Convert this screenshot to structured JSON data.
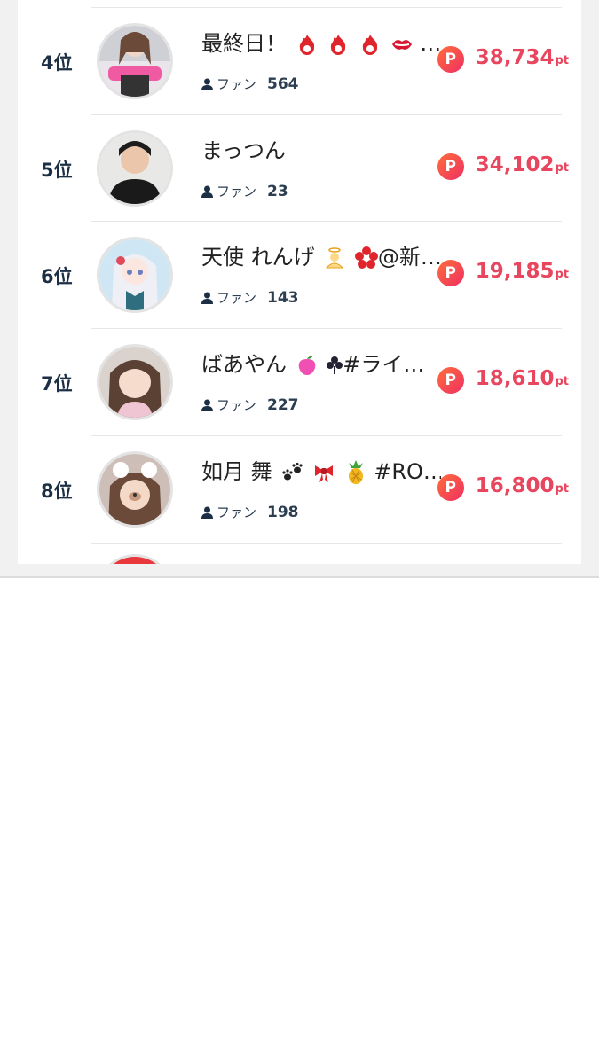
{
  "ranking": {
    "point_badge_letter": "P",
    "point_unit": "pt",
    "fan_label": "ファン",
    "rows": [
      {
        "rank": "4位",
        "name": "最終日！",
        "fans": "564",
        "points": "38,734"
      },
      {
        "rank": "5位",
        "name": "まっつん",
        "fans": "23",
        "points": "34,102"
      },
      {
        "rank": "6位",
        "name": "天使 れんげ",
        "name_suffix": "@新…",
        "fans": "143",
        "points": "19,185"
      },
      {
        "rank": "7位",
        "name": "ばあやん",
        "name_suffix": "#ライ…",
        "fans": "227",
        "points": "18,610"
      },
      {
        "rank": "8位",
        "name": "如月 舞",
        "name_suffix": "#RO…",
        "fans": "198",
        "points": "16,800"
      }
    ]
  },
  "colors": {
    "points_text": "#e8455e",
    "rank_text": "#1c2f44",
    "background": "#f1f1f1"
  }
}
